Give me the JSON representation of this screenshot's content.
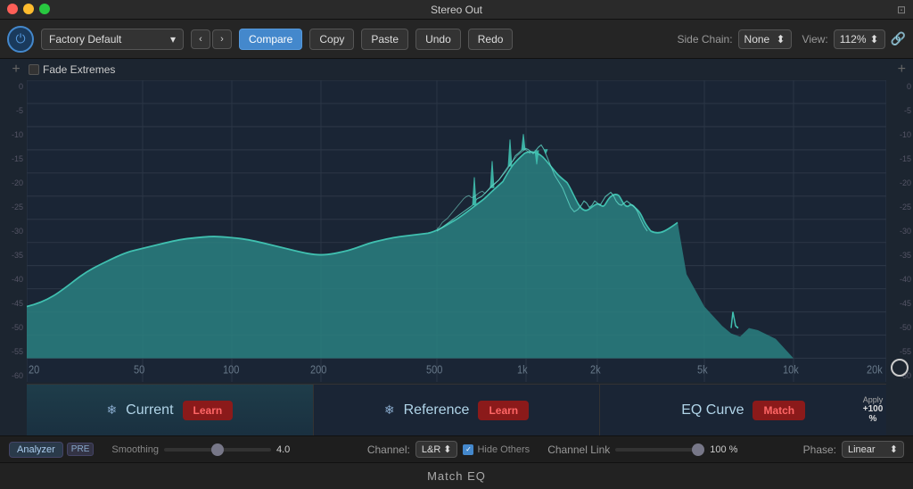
{
  "window": {
    "title": "Stereo Out",
    "plugin_title": "Match EQ"
  },
  "toolbar": {
    "preset_name": "Factory Default",
    "compare_label": "Compare",
    "copy_label": "Copy",
    "paste_label": "Paste",
    "undo_label": "Undo",
    "redo_label": "Redo",
    "side_chain_label": "Side Chain:",
    "side_chain_value": "None",
    "view_label": "View:",
    "view_value": "112%"
  },
  "eq_header": {
    "add_left": "+",
    "fade_extremes_label": "Fade Extremes",
    "add_right": "+"
  },
  "y_axis": {
    "labels": [
      "0",
      "-5",
      "-10",
      "-15",
      "-20",
      "-25",
      "-30",
      "-35",
      "-40",
      "-45",
      "-50",
      "-55",
      "-60"
    ]
  },
  "x_axis": {
    "labels": [
      "20",
      "50",
      "100",
      "200",
      "500",
      "1k",
      "2k",
      "5k",
      "10k",
      "20k"
    ]
  },
  "sections": {
    "current": {
      "name": "Current",
      "learn_label": "Learn"
    },
    "reference": {
      "name": "Reference",
      "learn_label": "Learn"
    },
    "eqcurve": {
      "name": "EQ Curve",
      "match_label": "Match"
    }
  },
  "apply": {
    "label": "Apply",
    "value": "+100 %"
  },
  "bottom_controls": {
    "analyzer_label": "Analyzer",
    "pre_label": "PRE",
    "smoothing_label": "Smoothing",
    "smoothing_value": "4.0",
    "channel_label": "Channel:",
    "channel_value": "L&R",
    "hide_others_label": "Hide Others",
    "channel_link_label": "Channel Link",
    "channel_link_value": "100 %",
    "phase_label": "Phase:",
    "phase_value": "Linear"
  }
}
